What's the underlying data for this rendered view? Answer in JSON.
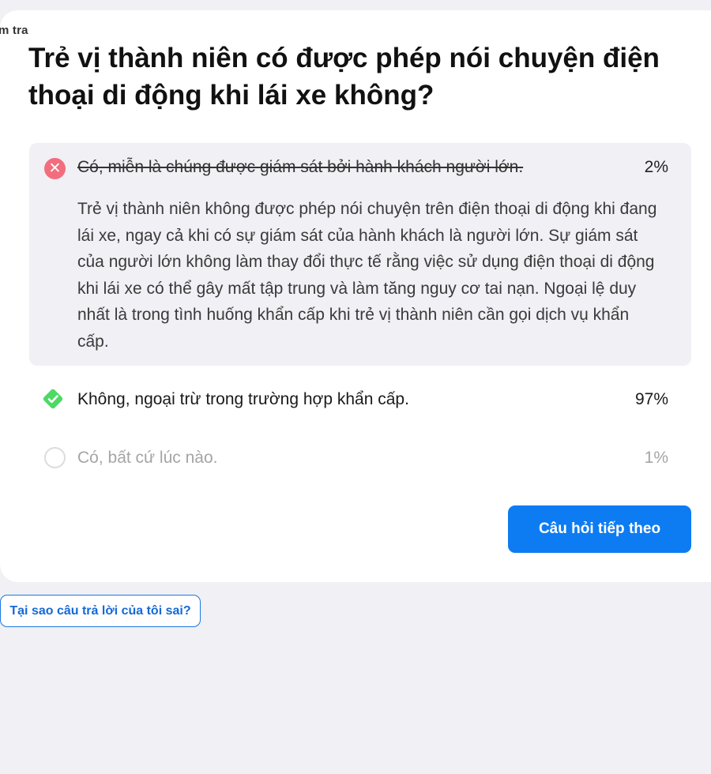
{
  "section_label": "m tra",
  "question": "Trẻ vị thành niên có được phép nói chuyện điện thoại di động khi lái xe không?",
  "answers": [
    {
      "text": "Có, miễn là chúng được giám sát bởi hành khách người lớn.",
      "percent": "2%",
      "state": "selected-wrong",
      "icon": "close-icon",
      "explanation": "Trẻ vị thành niên không được phép nói chuyện trên điện thoại di động khi đang lái xe, ngay cả khi có sự giám sát của hành khách là người lớn. Sự giám sát của người lớn không làm thay đổi thực tế rằng việc sử dụng điện thoại di động khi lái xe có thể gây mất tập trung và làm tăng nguy cơ tai nạn. Ngoại lệ duy nhất là trong tình huống khẩn cấp khi trẻ vị thành niên cần gọi dịch vụ khẩn cấp."
    },
    {
      "text": "Không, ngoại trừ trong trường hợp khẩn cấp.",
      "percent": "97%",
      "state": "correct",
      "icon": "check-diamond-icon"
    },
    {
      "text": "Có, bất cứ lúc nào.",
      "percent": "1%",
      "state": "unselected",
      "icon": "empty-circle-icon"
    }
  ],
  "buttons": {
    "next": "Câu hỏi tiếp theo",
    "why_wrong": "Tại sao câu trả lời của tôi sai?"
  },
  "colors": {
    "accent": "#0d7cf2",
    "wrong": "#f26d7d",
    "correct": "#4cd964",
    "background": "#f0f0f5"
  }
}
